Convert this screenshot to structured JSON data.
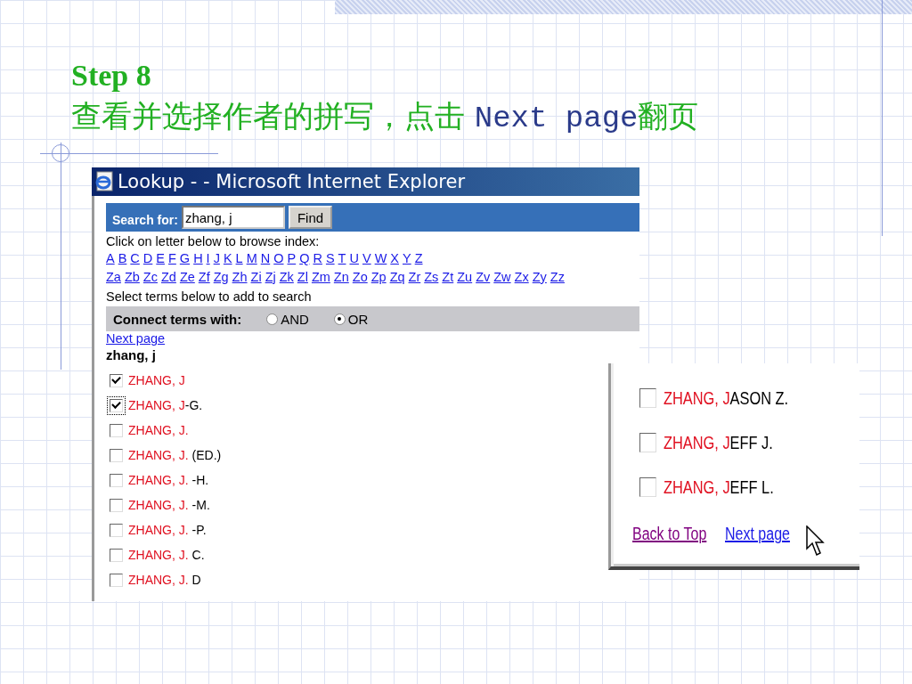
{
  "slide": {
    "step": "Step 8",
    "subtitle": [
      {
        "kind": "zh",
        "text": "查看并选择作者的拼写，点击 "
      },
      {
        "kind": "code",
        "text": "Next page"
      },
      {
        "kind": "zh",
        "text": "翻页"
      }
    ]
  },
  "window": {
    "title": "Lookup - - Microsoft Internet Explorer"
  },
  "search": {
    "label": "Search for:",
    "value": "zhang, j",
    "button": "Find"
  },
  "browse_hint": "Click on letter below to browse index:",
  "letters": [
    [
      "A",
      "B",
      "C",
      "D",
      "E",
      "F",
      "G",
      "H",
      "I",
      "J",
      "K",
      "L",
      "M",
      "N",
      "O",
      "P",
      "Q",
      "R",
      "S",
      "T",
      "U",
      "V",
      "W",
      "X",
      "Y",
      "Z"
    ],
    [
      "Za",
      "Zb",
      "Zc",
      "Zd",
      "Ze",
      "Zf",
      "Zg",
      "Zh",
      "Zi",
      "Zj",
      "Zk",
      "Zl",
      "Zm",
      "Zn",
      "Zo",
      "Zp",
      "Zq",
      "Zr",
      "Zs",
      "Zt",
      "Zu",
      "Zv",
      "Zw",
      "Zx",
      "Zy",
      "Zz"
    ]
  ],
  "select_hint": "Select terms below to add to search",
  "connect": {
    "label": "Connect terms with:",
    "options": [
      {
        "label": "AND",
        "selected": false
      },
      {
        "label": "OR",
        "selected": true
      }
    ]
  },
  "next_link": "Next page",
  "heading": "zhang, j",
  "terms": [
    {
      "name": "ZHANG, J",
      "checked": true,
      "focused": false
    },
    {
      "name": "ZHANG, J",
      "rest": "-G.",
      "checked": true,
      "focused": true
    },
    {
      "name": "ZHANG, J.",
      "checked": false,
      "focused": false
    },
    {
      "name": "ZHANG, J.",
      "rest": " (ED.)",
      "checked": false,
      "focused": false
    },
    {
      "name": "ZHANG, J.",
      "rest": " -H.",
      "checked": false,
      "focused": false
    },
    {
      "name": "ZHANG, J.",
      "rest": " -M.",
      "checked": false,
      "focused": false
    },
    {
      "name": "ZHANG, J.",
      "rest": " -P.",
      "checked": false,
      "focused": false
    },
    {
      "name": "ZHANG, J.",
      "rest": " C.",
      "checked": false,
      "focused": false
    },
    {
      "name": "ZHANG, J.",
      "rest": " D",
      "checked": false,
      "focused": false
    }
  ],
  "inset": {
    "terms": [
      {
        "name": "ZHANG, J",
        "rest": "ASON Z.",
        "checked": false
      },
      {
        "name": "ZHANG, J",
        "rest": "EFF J.",
        "checked": false
      },
      {
        "name": "ZHANG, J",
        "rest": "EFF L.",
        "checked": false
      }
    ],
    "links": [
      {
        "label": "Back to Top",
        "visited": true
      },
      {
        "label": "Next page",
        "visited": false
      }
    ]
  }
}
